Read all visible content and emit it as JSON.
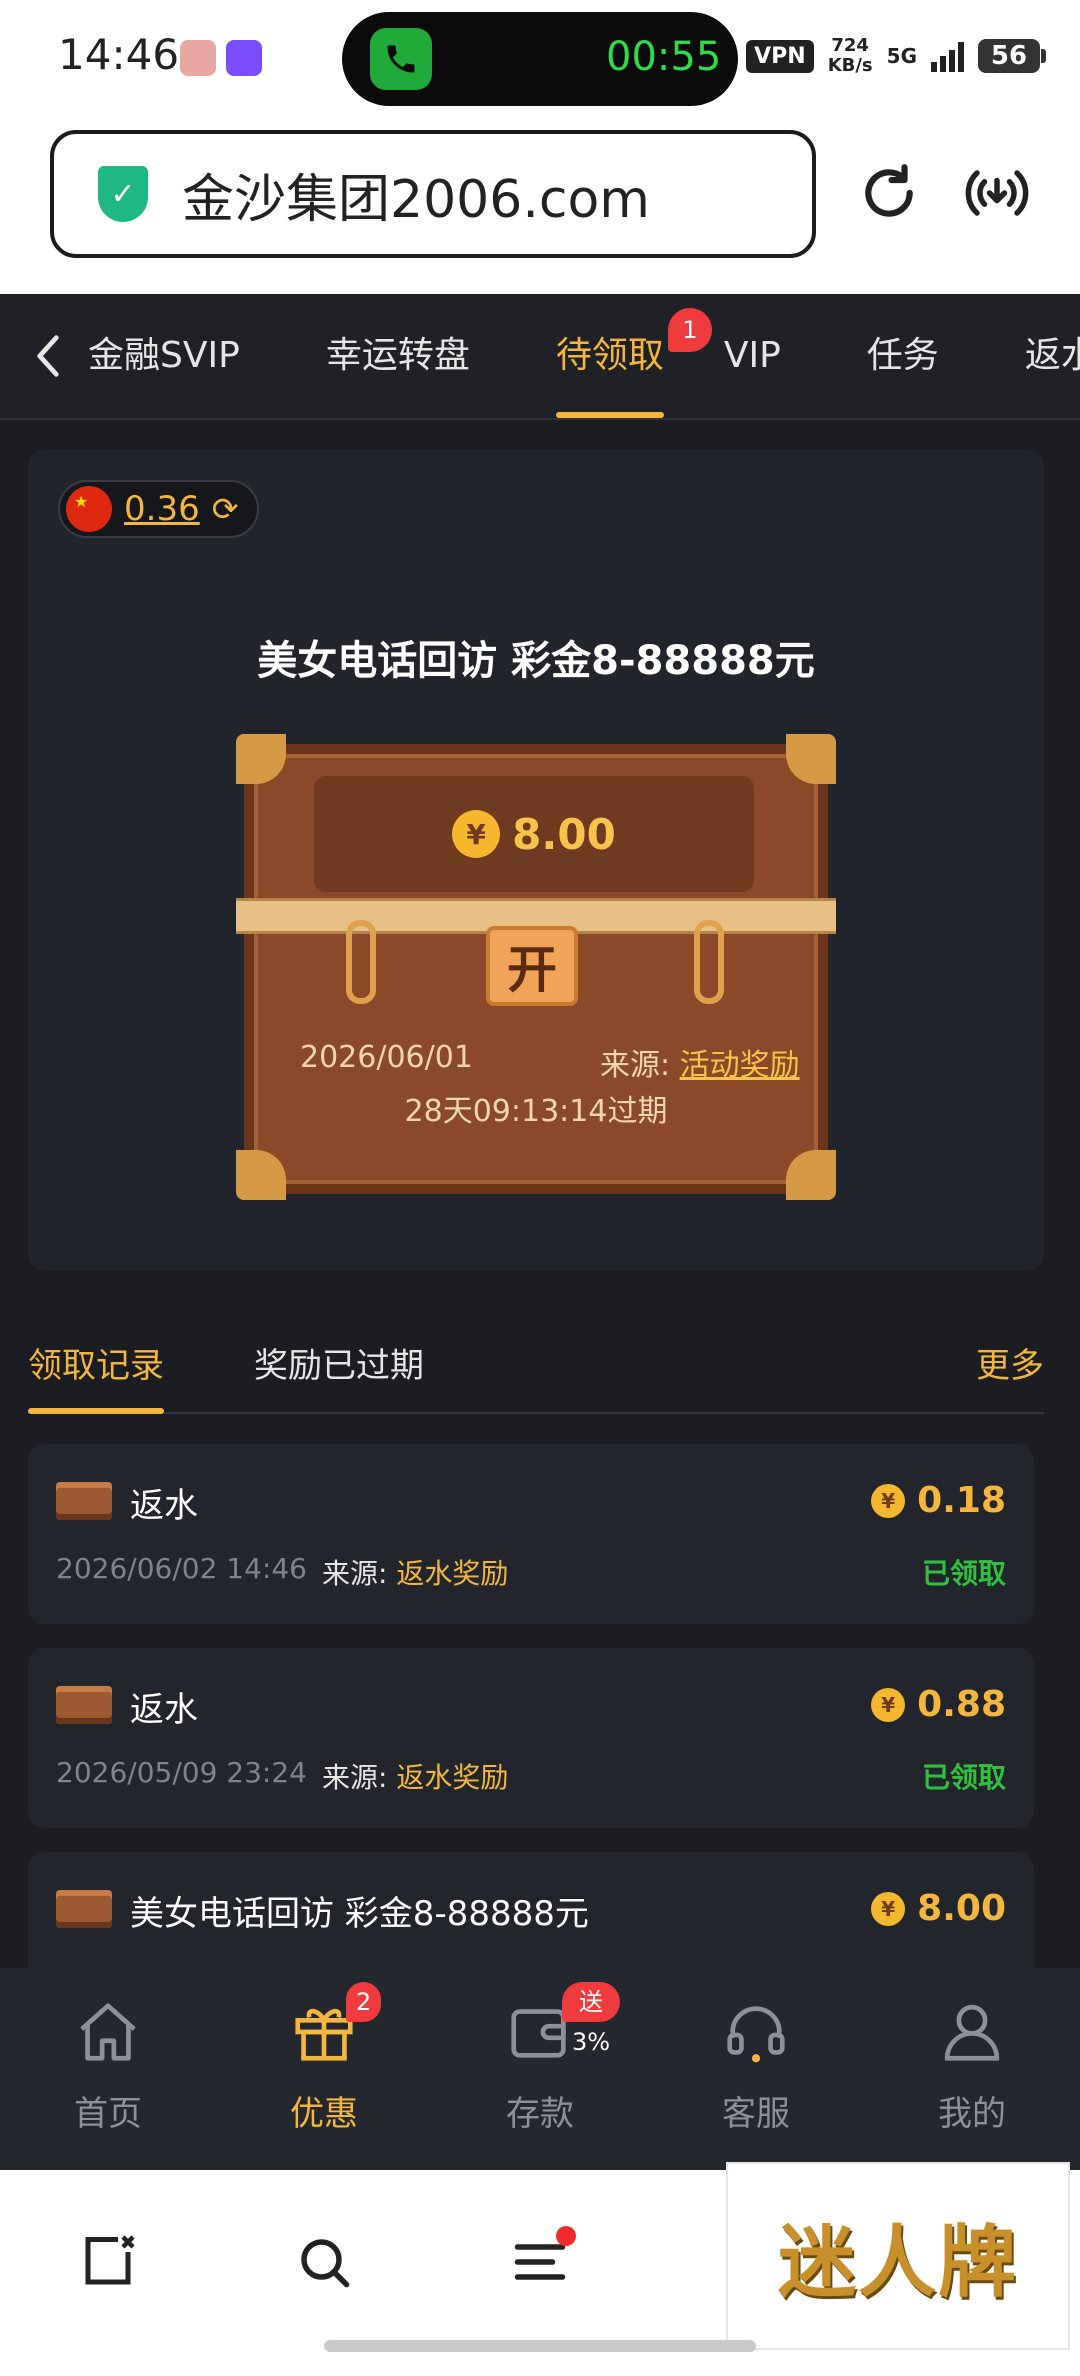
{
  "status_bar": {
    "time": "14:46",
    "call_time": "00:55",
    "vpn": "VPN",
    "speed_value": "724",
    "speed_unit": "KB/s",
    "network": "5G",
    "battery": "56"
  },
  "browser": {
    "url": "金沙集团2006.com"
  },
  "top_tabs": {
    "items": [
      {
        "label": "金融SVIP"
      },
      {
        "label": "幸运转盘"
      },
      {
        "label": "待领取",
        "active": true,
        "badge": "1"
      },
      {
        "label": "VIP"
      },
      {
        "label": "任务"
      },
      {
        "label": "返水"
      }
    ]
  },
  "balance": {
    "value": "0.36"
  },
  "chest": {
    "title": "美女电话回访 彩金8-88888元",
    "amount": "8.00",
    "currency_symbol": "¥",
    "lock_label": "开",
    "date": "2026/06/01",
    "source_label": "来源:",
    "source_value": "活动奖励",
    "expire_text": "28天09:13:14过期"
  },
  "record_tabs": {
    "tab1": "领取记录",
    "tab2": "奖励已过期",
    "more": "更多"
  },
  "records": [
    {
      "title": "返水",
      "amount": "0.18",
      "date": "2026/06/02 14:46",
      "source_label": "来源:",
      "source_value": "返水奖励",
      "status": "已领取"
    },
    {
      "title": "返水",
      "amount": "0.88",
      "date": "2026/05/09 23:24",
      "source_label": "来源:",
      "source_value": "返水奖励",
      "status": "已领取"
    },
    {
      "title": "美女电话回访 彩金8-88888元",
      "amount": "8.00",
      "date": "",
      "source_label": "",
      "source_value": "",
      "status": ""
    }
  ],
  "app_nav": {
    "items": [
      {
        "label": "首页",
        "icon": "home-icon"
      },
      {
        "label": "优惠",
        "icon": "gift-icon",
        "active": true,
        "badge": "2"
      },
      {
        "label": "存款",
        "icon": "wallet-icon",
        "badge": "送3%"
      },
      {
        "label": "客服",
        "icon": "headset-icon"
      },
      {
        "label": "我的",
        "icon": "user-icon"
      }
    ]
  },
  "watermark": {
    "text": "迷人牌"
  },
  "colors": {
    "accent": "#f4b63e",
    "background": "#1b1d22",
    "success": "#2fc23f",
    "badge": "#ef3b3b"
  }
}
